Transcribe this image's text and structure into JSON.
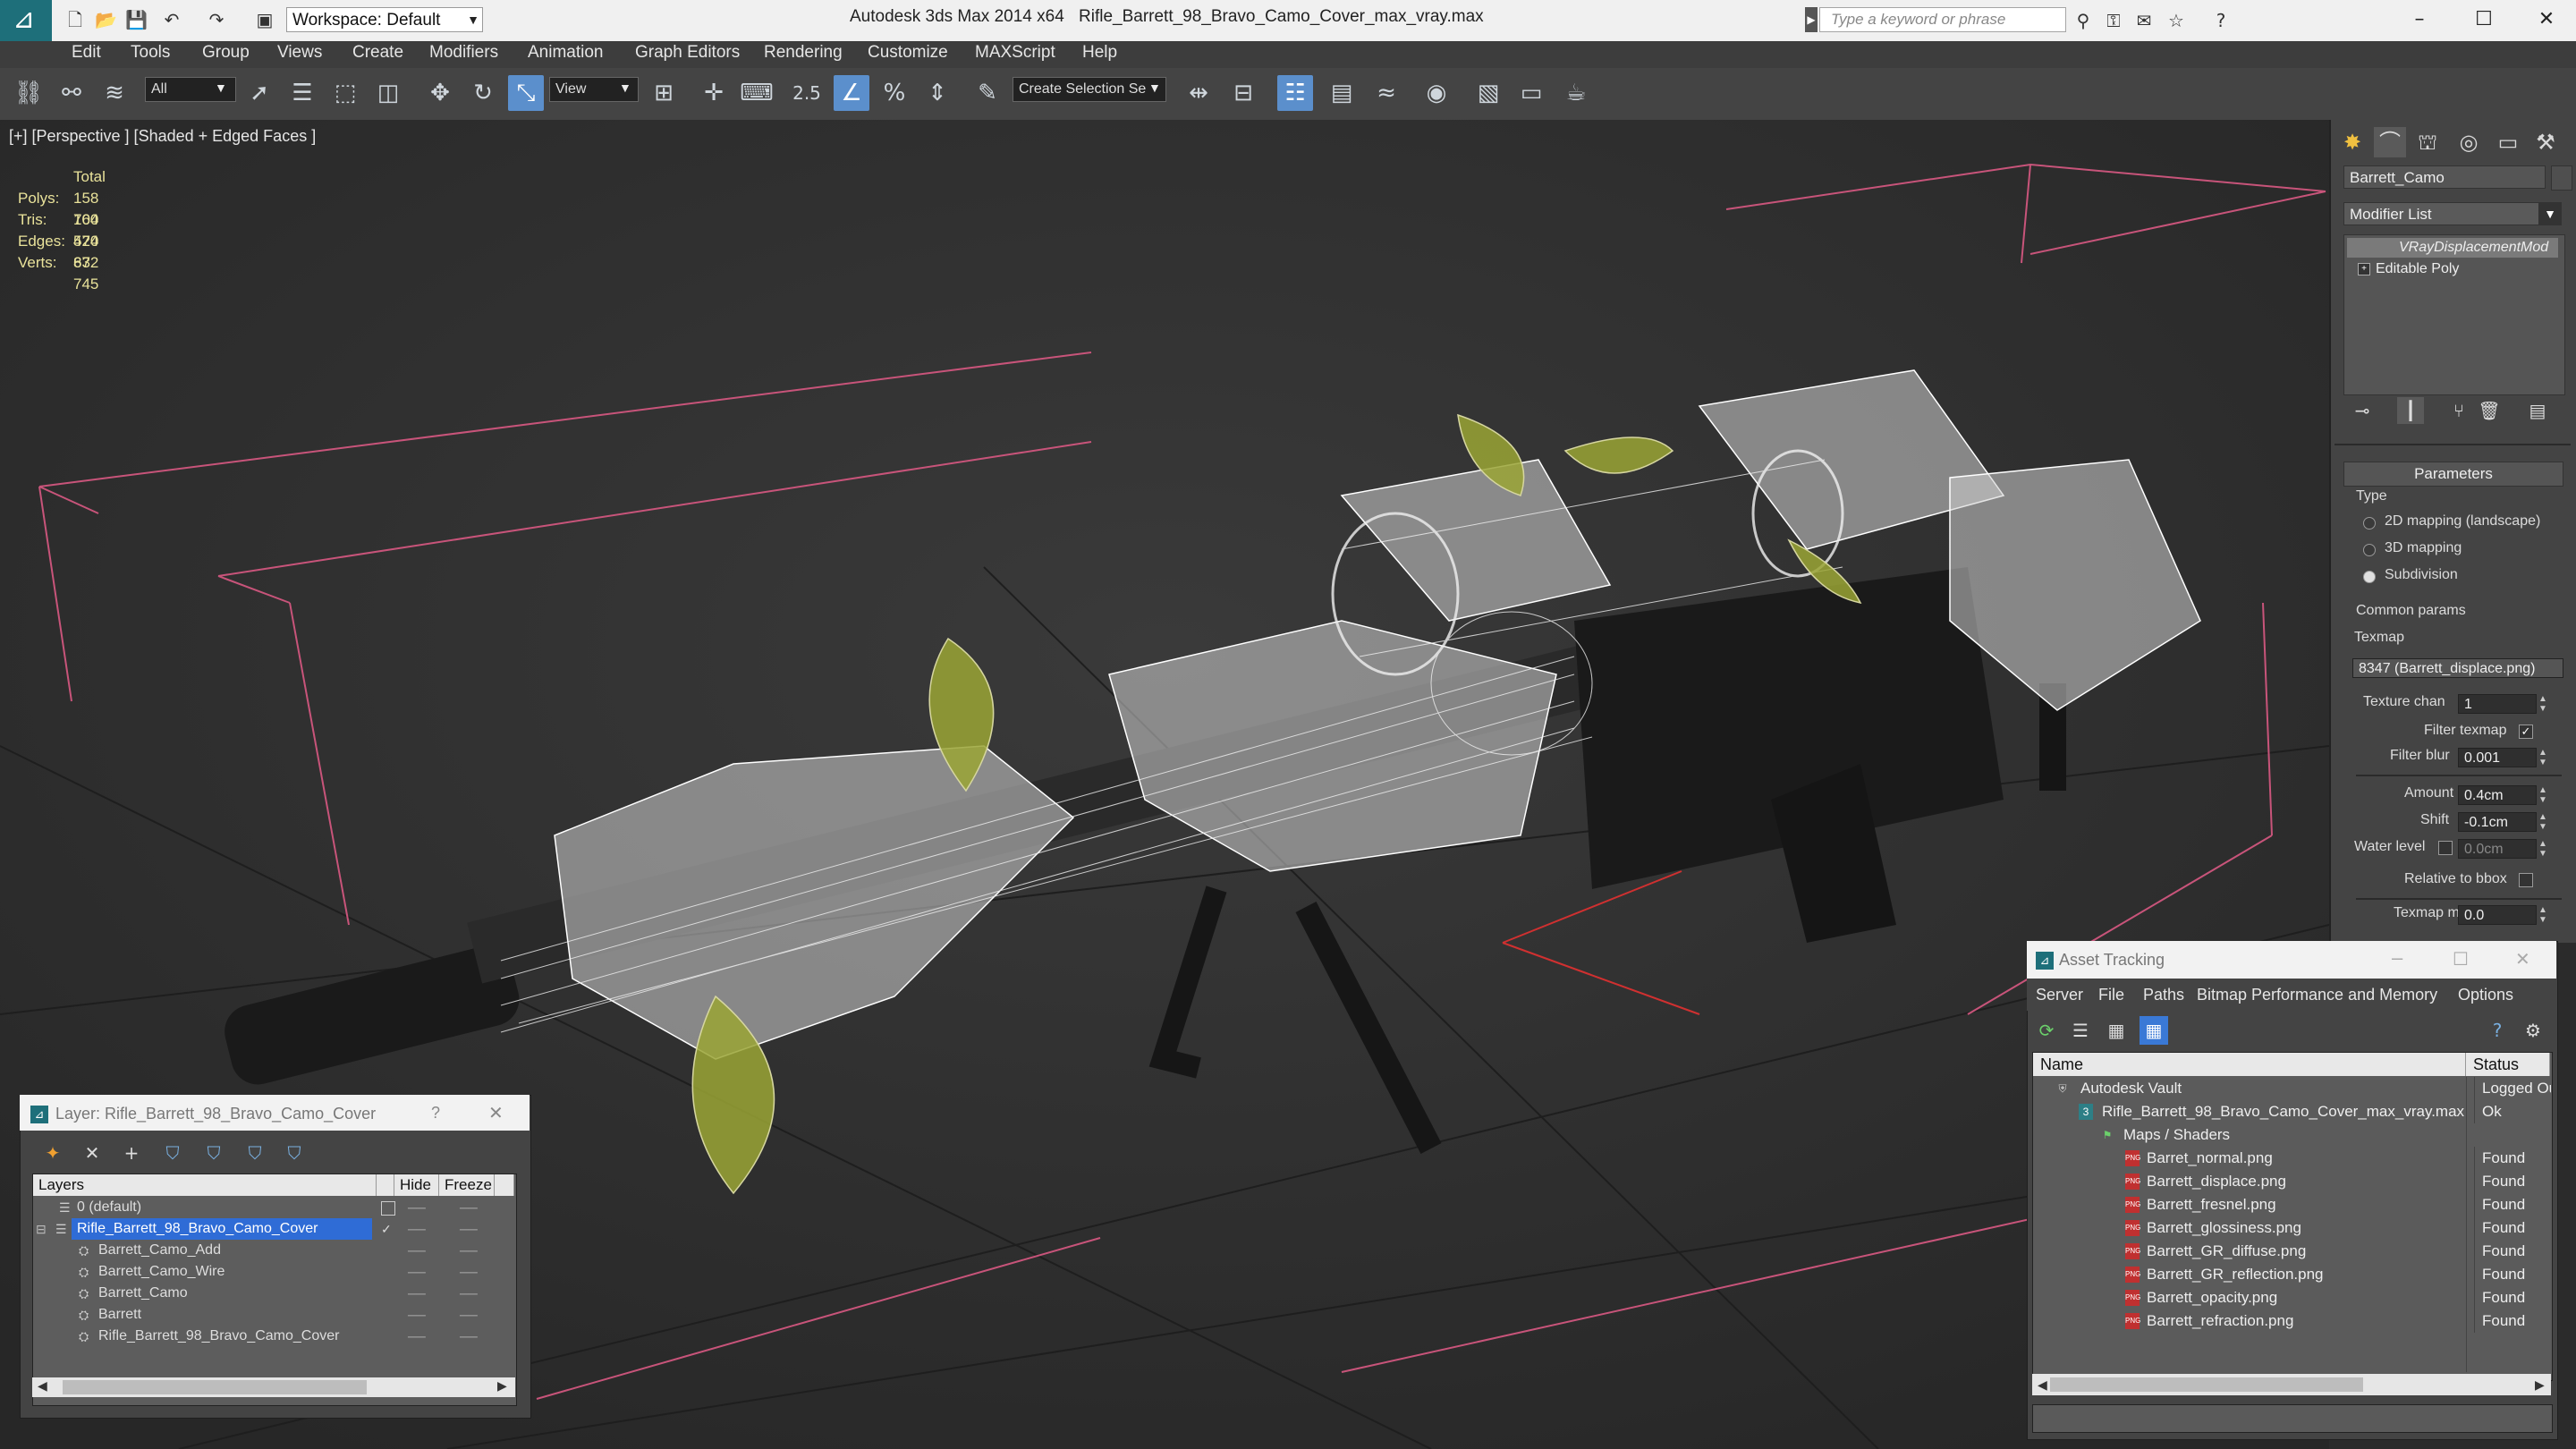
{
  "titlebar": {
    "app_title": "Autodesk 3ds Max 2014 x64",
    "file_title": "Rifle_Barrett_98_Bravo_Camo_Cover_max_vray.max",
    "workspace": "Workspace: Default",
    "search_placeholder": "Type a keyword or phrase"
  },
  "menu": [
    "Edit",
    "Tools",
    "Group",
    "Views",
    "Create",
    "Modifiers",
    "Animation",
    "Graph Editors",
    "Rendering",
    "Customize",
    "MAXScript",
    "Help"
  ],
  "toolbar": {
    "selection_filter": "All",
    "ref_coord": "View",
    "snap_label": "2.5",
    "named_selection": "Create Selection Se"
  },
  "viewport": {
    "label": "[+] [Perspective ] [Shaded + Edged Faces ]",
    "stats": {
      "header": "Total",
      "rows": [
        {
          "label": "Polys:",
          "value": "158 704"
        },
        {
          "label": "Tris:",
          "value": "160 520"
        },
        {
          "label": "Edges:",
          "value": "474 672"
        },
        {
          "label": "Verts:",
          "value": "83 745"
        }
      ]
    }
  },
  "command_panel": {
    "object_name": "Barrett_Camo",
    "modifier_list": "Modifier List",
    "stack": [
      "VRayDisplacementMod",
      "Editable Poly"
    ],
    "rollout": "Parameters",
    "type_label": "Type",
    "type_options": [
      "2D mapping (landscape)",
      "3D mapping",
      "Subdivision"
    ],
    "type_selected": 2,
    "common_params": "Common params",
    "texmap_label": "Texmap",
    "texmap_value": "8347 (Barrett_displace.png)",
    "texture_chan_label": "Texture chan",
    "texture_chan_value": "1",
    "filter_texmap_label": "Filter texmap",
    "filter_blur_label": "Filter blur",
    "filter_blur_value": "0.001",
    "amount_label": "Amount",
    "amount_value": "0.4cm",
    "shift_label": "Shift",
    "shift_value": "-0.1cm",
    "water_level_label": "Water level",
    "water_level_value": "0.0cm",
    "relative_label": "Relative to bbox",
    "texmap_min_label": "Texmap min",
    "texmap_min_value": "0.0"
  },
  "layer_dialog": {
    "title": "Layer: Rifle_Barrett_98_Bravo_Camo_Cover",
    "help": "?",
    "columns": [
      "Layers",
      "Hide",
      "Freeze"
    ],
    "rows": [
      {
        "name": "0 (default)",
        "selected": false,
        "indent": 0
      },
      {
        "name": "Rifle_Barrett_98_Bravo_Camo_Cover",
        "selected": true,
        "indent": 0
      },
      {
        "name": "Barrett_Camo_Add",
        "selected": false,
        "indent": 1
      },
      {
        "name": "Barrett_Camo_Wire",
        "selected": false,
        "indent": 1
      },
      {
        "name": "Barrett_Camo",
        "selected": false,
        "indent": 1
      },
      {
        "name": "Barrett",
        "selected": false,
        "indent": 1
      },
      {
        "name": "Rifle_Barrett_98_Bravo_Camo_Cover",
        "selected": false,
        "indent": 1
      }
    ]
  },
  "asset_tracking": {
    "title": "Asset Tracking",
    "menu": [
      "Server",
      "File",
      "Paths",
      "Bitmap Performance and Memory",
      "Options"
    ],
    "columns": [
      "Name",
      "Status"
    ],
    "rows": [
      {
        "name": "Autodesk Vault",
        "status": "Logged Ou",
        "indent": 0,
        "icon": "vault-icon"
      },
      {
        "name": "Rifle_Barrett_98_Bravo_Camo_Cover_max_vray.max",
        "status": "Ok",
        "indent": 1,
        "icon": "max-file-icon"
      },
      {
        "name": "Maps / Shaders",
        "status": "",
        "indent": 2,
        "icon": "maps-folder-icon"
      },
      {
        "name": "Barret_normal.png",
        "status": "Found",
        "indent": 3,
        "icon": "png-icon"
      },
      {
        "name": "Barrett_displace.png",
        "status": "Found",
        "indent": 3,
        "icon": "png-icon"
      },
      {
        "name": "Barrett_fresnel.png",
        "status": "Found",
        "indent": 3,
        "icon": "png-icon"
      },
      {
        "name": "Barrett_glossiness.png",
        "status": "Found",
        "indent": 3,
        "icon": "png-icon"
      },
      {
        "name": "Barrett_GR_diffuse.png",
        "status": "Found",
        "indent": 3,
        "icon": "png-icon"
      },
      {
        "name": "Barrett_GR_reflection.png",
        "status": "Found",
        "indent": 3,
        "icon": "png-icon"
      },
      {
        "name": "Barrett_opacity.png",
        "status": "Found",
        "indent": 3,
        "icon": "png-icon"
      },
      {
        "name": "Barrett_refraction.png",
        "status": "Found",
        "indent": 3,
        "icon": "png-icon"
      }
    ]
  },
  "colors": {
    "accent": "#3a79d6",
    "stats_text": "#e9e29a",
    "grid_bbox": "#c8547a",
    "viewport_bg": "#2f2f2f"
  }
}
